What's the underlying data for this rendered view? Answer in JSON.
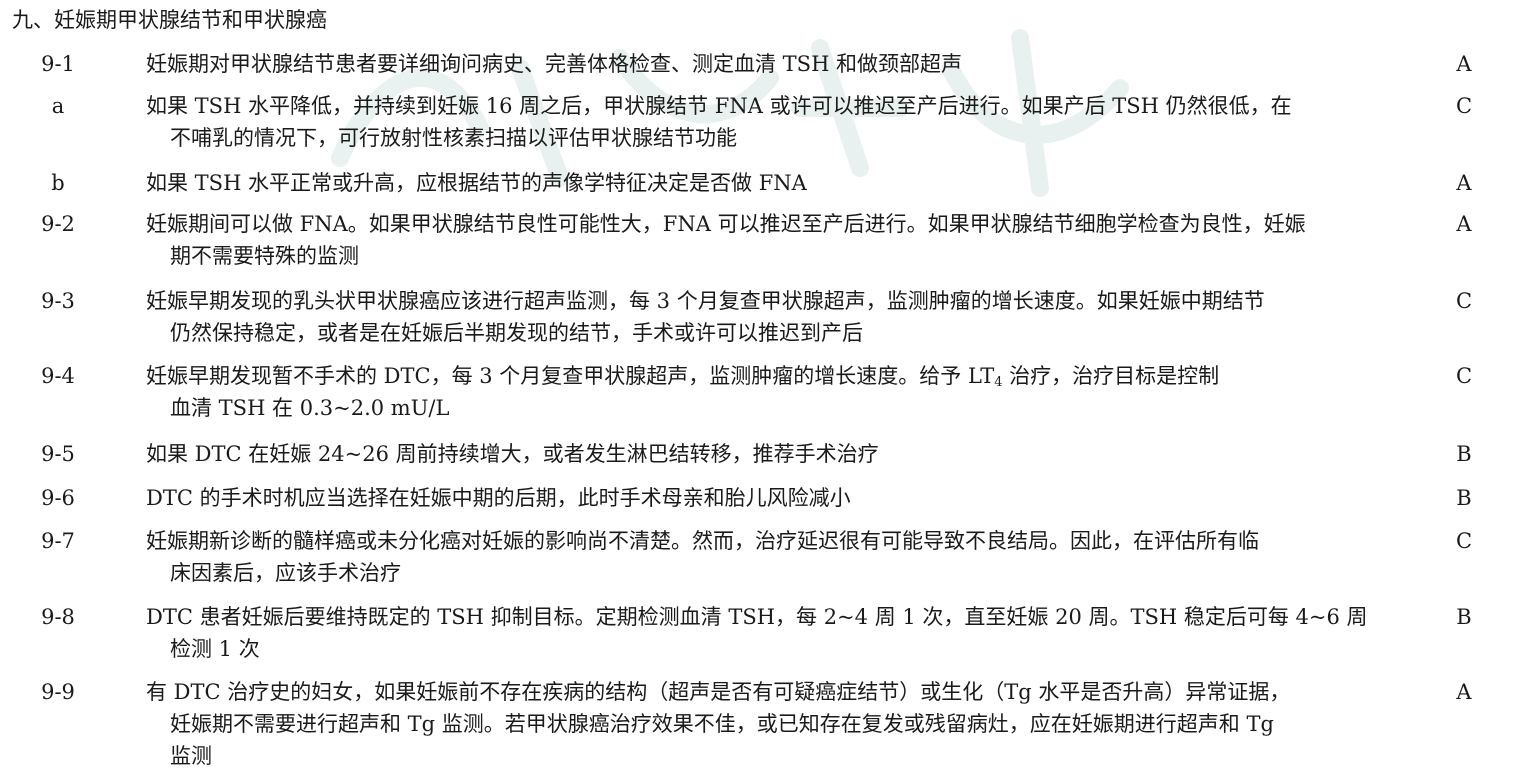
{
  "section": {
    "title": "九、妊娠期甲状腺结节和甲状腺癌"
  },
  "rows": [
    {
      "id": "9-1",
      "lines": [
        "妊娠期对甲状腺结节患者要详细询问病史、完善体格检查、测定血清 TSH 和做颈部超声"
      ],
      "grade": "A"
    },
    {
      "id": "a",
      "lines": [
        "如果 TSH 水平降低，并持续到妊娠 16 周之后，甲状腺结节 FNA 或许可以推迟至产后进行。如果产后 TSH 仍然很低，在",
        "不哺乳的情况下，可行放射性核素扫描以评估甲状腺结节功能"
      ],
      "grade": "C"
    },
    {
      "id": "b",
      "lines": [
        "如果 TSH 水平正常或升高，应根据结节的声像学特征决定是否做 FNA"
      ],
      "grade": "A"
    },
    {
      "id": "9-2",
      "lines": [
        "妊娠期间可以做 FNA。如果甲状腺结节良性可能性大，FNA 可以推迟至产后进行。如果甲状腺结节细胞学检查为良性，妊娠",
        "期不需要特殊的监测"
      ],
      "grade": "A"
    },
    {
      "id": "9-3",
      "lines": [
        "妊娠早期发现的乳头状甲状腺癌应该进行超声监测，每 3 个月复查甲状腺超声，监测肿瘤的增长速度。如果妊娠中期结节",
        "仍然保持稳定，或者是在妊娠后半期发现的结节，手术或许可以推迟到产后"
      ],
      "grade": "C"
    },
    {
      "id": "9-4",
      "lines_html_parts": {
        "line1_a": "妊娠早期发现暂不手术的 DTC，每 3 个月复查甲状腺超声，监测肿瘤的增长速度。给予 LT",
        "line1_sub": "4",
        "line1_b": " 治疗，治疗目标是控制",
        "line2": "血清 TSH 在 0.3~2.0 mU/L"
      },
      "grade": "C"
    },
    {
      "id": "9-5",
      "lines": [
        "如果 DTC 在妊娠 24~26 周前持续增大，或者发生淋巴结转移，推荐手术治疗"
      ],
      "grade": "B"
    },
    {
      "id": "9-6",
      "lines": [
        "DTC 的手术时机应当选择在妊娠中期的后期，此时手术母亲和胎儿风险减小"
      ],
      "grade": "B"
    },
    {
      "id": "9-7",
      "lines": [
        "妊娠期新诊断的髓样癌或未分化癌对妊娠的影响尚不清楚。然而，治疗延迟很有可能导致不良结局。因此，在评估所有临",
        "床因素后，应该手术治疗"
      ],
      "grade": "C"
    },
    {
      "id": "9-8",
      "lines": [
        "DTC 患者妊娠后要维持既定的 TSH 抑制目标。定期检测血清 TSH，每 2~4 周 1 次，直至妊娠 20 周。TSH 稳定后可每 4~6 周",
        "检测 1 次"
      ],
      "grade": "B"
    },
    {
      "id": "9-9",
      "lines": [
        "有 DTC 治疗史的妇女，如果妊娠前不存在疾病的结构（超声是否有可疑癌症结节）或生化（Tg 水平是否升高）异常证据，",
        "妊娠期不需要进行超声和 Tg 监测。若甲状腺癌治疗效果不佳，或已知存在复发或残留病灶，应在妊娠期进行超声和 Tg",
        "监测"
      ],
      "grade": "A"
    }
  ]
}
